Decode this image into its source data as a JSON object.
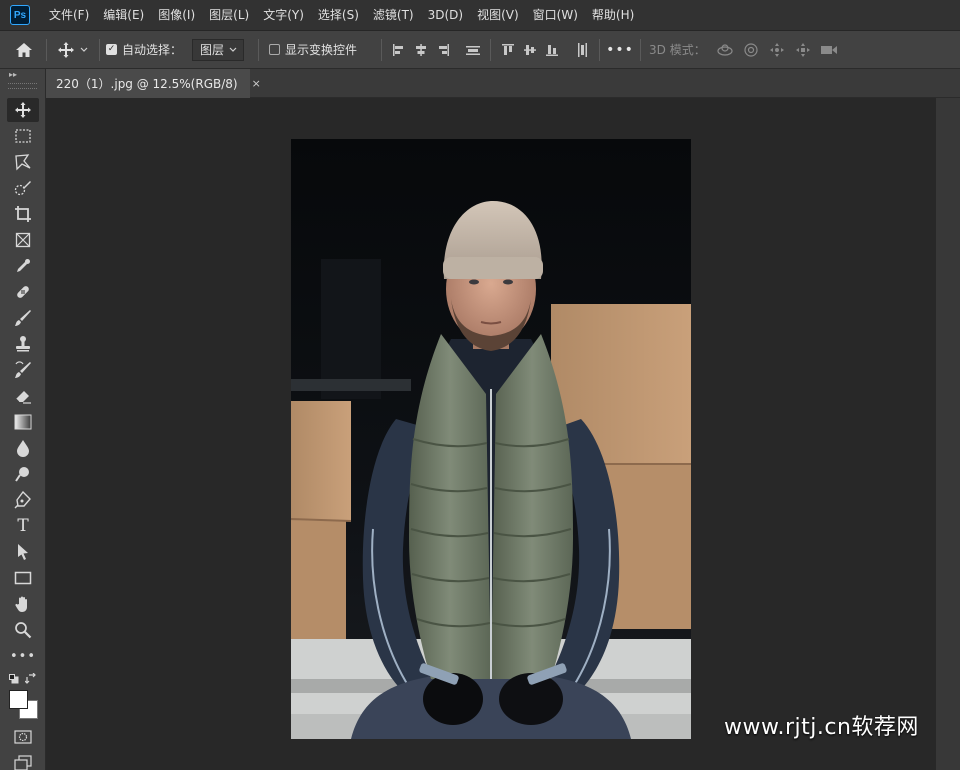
{
  "app": {
    "logo": "Ps",
    "menu": [
      "文件(F)",
      "编辑(E)",
      "图像(I)",
      "图层(L)",
      "文字(Y)",
      "选择(S)",
      "滤镜(T)",
      "3D(D)",
      "视图(V)",
      "窗口(W)",
      "帮助(H)"
    ]
  },
  "options": {
    "auto_select_label": "自动选择：",
    "auto_select_checked": true,
    "layer_select_value": "图层",
    "transform_controls_label": "显示变换控件",
    "transform_controls_checked": false,
    "mode_3d_label": "3D 模式："
  },
  "document": {
    "tab_title": "220（1）.jpg @ 12.5%(RGB/8)",
    "close_glyph": "×"
  },
  "tools": [
    "move",
    "marquee",
    "lasso",
    "quick-select",
    "crop",
    "frame",
    "eyedropper",
    "healing",
    "brush",
    "stamp",
    "history-brush",
    "eraser",
    "gradient",
    "blur",
    "dodge",
    "pen",
    "type",
    "path-select",
    "rectangle",
    "hand",
    "zoom",
    "more",
    "default-colors",
    "swap-colors",
    "color-swatches",
    "quick-mask",
    "screen-mode"
  ],
  "colors": {
    "foreground": "#ffffff",
    "background": "#ffffff",
    "accent": "#31a8ff"
  },
  "watermark": "www.rjtj.cn软荐网"
}
